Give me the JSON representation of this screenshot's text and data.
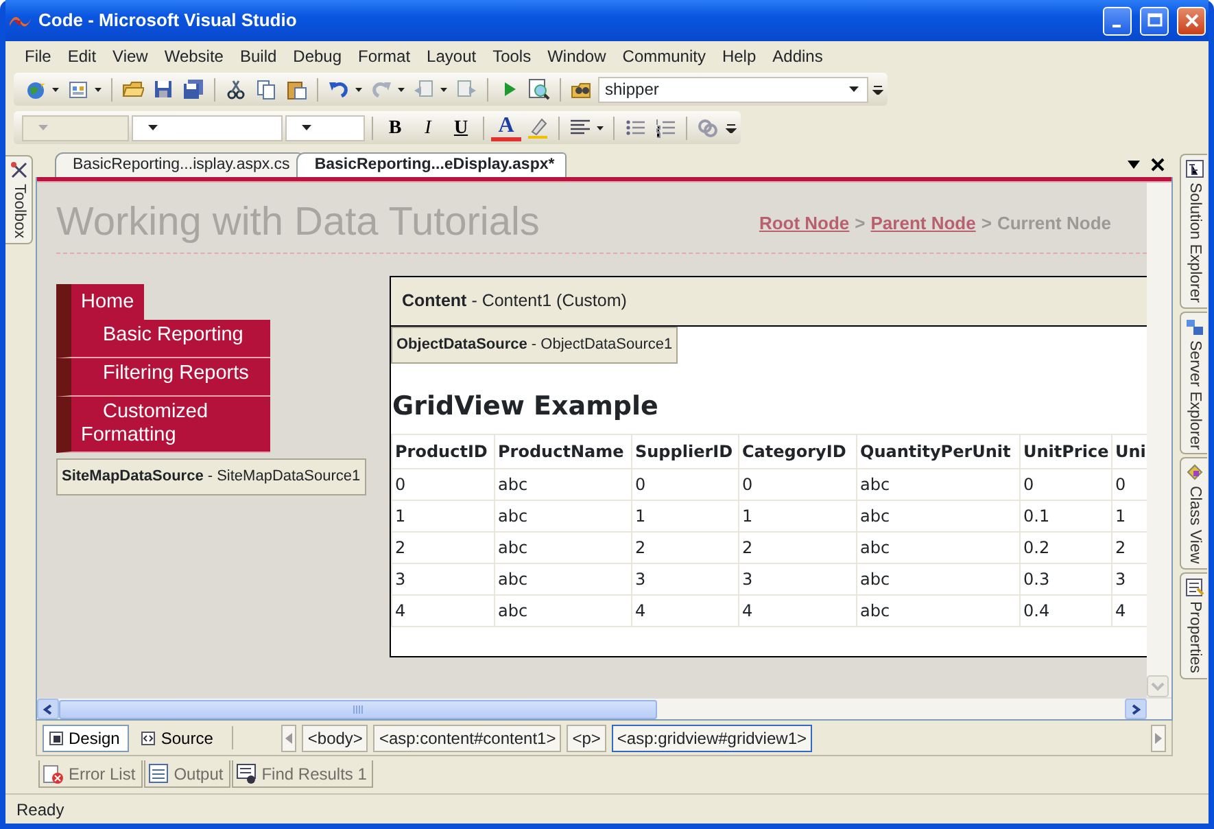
{
  "window": {
    "title": "Code - Microsoft Visual Studio"
  },
  "menu": [
    "File",
    "Edit",
    "View",
    "Website",
    "Build",
    "Debug",
    "Format",
    "Layout",
    "Tools",
    "Window",
    "Community",
    "Help",
    "Addins"
  ],
  "toolbar": {
    "find_combo": "shipper"
  },
  "format_toolbar": {
    "buttons": [
      {
        "label": "B",
        "kind": "bold"
      },
      {
        "label": "I",
        "kind": "italic"
      },
      {
        "label": "U",
        "kind": "underline"
      }
    ],
    "font_color": "A"
  },
  "left_tabs": [
    "Toolbox"
  ],
  "document_tabs": [
    {
      "label": "BasicReporting...isplay.aspx.cs",
      "selected": false
    },
    {
      "label": "BasicReporting...eDisplay.aspx*",
      "selected": true
    }
  ],
  "designer": {
    "site_title": "Working with Data Tutorials",
    "breadcrumb": [
      {
        "label": "Root Node",
        "kind": "link"
      },
      {
        "label": ">",
        "kind": "separator"
      },
      {
        "label": "Parent Node",
        "kind": "link"
      },
      {
        "label": ">",
        "kind": "separator"
      },
      {
        "label": "Current Node",
        "kind": "current"
      }
    ],
    "nav_menu": [
      {
        "label": "Home",
        "children": [
          {
            "label": "Basic Reporting"
          },
          {
            "label": "Filtering Reports"
          },
          {
            "label": "Customized Formatting"
          }
        ]
      }
    ],
    "sitemap_source": "**SiteMapDataSource** - SiteMapDataSource1",
    "content_region": "**Content** - Content1 (Custom)",
    "object_source": "**ObjectDataSource** - ObjectDataSource1",
    "heading": "GridView Example",
    "grid": {
      "columns": [
        "ProductID",
        "ProductName",
        "SupplierID",
        "CategoryID",
        "QuantityPerUnit",
        "UnitPrice",
        "Uni"
      ],
      "rows": [
        [
          "0",
          "abc",
          "0",
          "0",
          "abc",
          "0",
          "0"
        ],
        [
          "1",
          "abc",
          "1",
          "1",
          "abc",
          "0.1",
          "1"
        ],
        [
          "2",
          "abc",
          "2",
          "2",
          "abc",
          "0.2",
          "2"
        ],
        [
          "3",
          "abc",
          "3",
          "3",
          "abc",
          "0.3",
          "3"
        ],
        [
          "4",
          "abc",
          "4",
          "4",
          "abc",
          "0.4",
          "4"
        ]
      ]
    }
  },
  "right_tabs": [
    "Solution Explorer",
    "Server Explorer",
    "Class View",
    "Properties"
  ],
  "view_tabs": [
    {
      "label": "Design",
      "selected": true
    },
    {
      "label": "Source",
      "selected": false
    }
  ],
  "tag_path": [
    {
      "label": "<body>",
      "selected": false
    },
    {
      "label": "<asp:content#content1>",
      "selected": false
    },
    {
      "label": "<p>",
      "selected": false
    },
    {
      "label": "<asp:gridview#gridview1>",
      "selected": true
    }
  ],
  "tool_windows": [
    "Error List",
    "Output",
    "Find Results 1"
  ],
  "status_bar": "Ready"
}
